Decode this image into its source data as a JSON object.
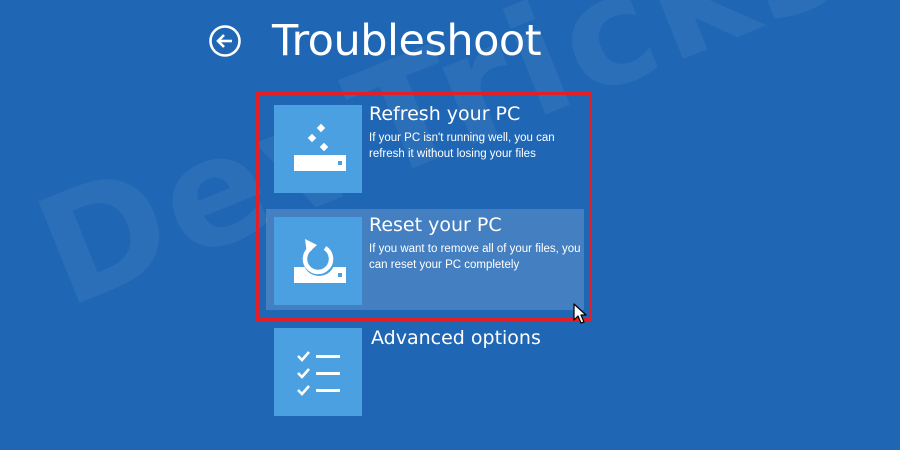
{
  "screen": {
    "title": "Troubleshoot",
    "watermark": "DevTricks"
  },
  "options": [
    {
      "title": "Refresh your PC",
      "description": "If your PC isn't running well, you can refresh it without losing your files",
      "icon": "refresh-pc-icon"
    },
    {
      "title": "Reset your PC",
      "description": "If you want to remove all of your files, you can reset your PC completely",
      "icon": "reset-pc-icon",
      "state": "hovered"
    },
    {
      "title": "Advanced options",
      "description": "",
      "icon": "checklist-icon"
    }
  ],
  "colors": {
    "background": "#1f67b5",
    "tile": "#4aa0e0",
    "highlight_border": "#e21f26",
    "text": "#ffffff"
  }
}
